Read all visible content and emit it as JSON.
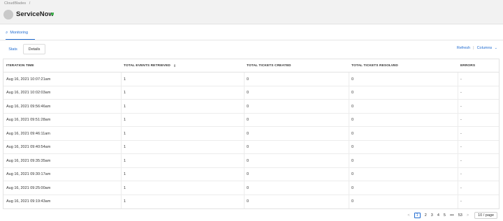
{
  "breadcrumb": {
    "root": "CloudBlades",
    "sep": "/"
  },
  "header": {
    "title": "ServiceNow"
  },
  "nav": {
    "monitoring_label": "Monitoring"
  },
  "tabs": {
    "stats": "Stats",
    "details": "Details"
  },
  "toolbar": {
    "refresh": "Refresh",
    "sep": "|",
    "columns": "Columns"
  },
  "table": {
    "headers": {
      "iteration_time": "ITERATION TIME",
      "total_events": "TOTAL EVENTS RETRIEVED",
      "tickets_created": "TOTAL TICKETS CREATED",
      "tickets_resolved": "TOTAL TICKETS RESOLVED",
      "errors": "ERRORS"
    },
    "rows": [
      {
        "time": "Aug 16, 2021 10:07:21am",
        "events": "1",
        "created": "0",
        "resolved": "0",
        "errors": "-"
      },
      {
        "time": "Aug 16, 2021 10:02:03am",
        "events": "1",
        "created": "0",
        "resolved": "0",
        "errors": "-"
      },
      {
        "time": "Aug 16, 2021 09:56:46am",
        "events": "1",
        "created": "0",
        "resolved": "0",
        "errors": "-"
      },
      {
        "time": "Aug 16, 2021 09:51:28am",
        "events": "1",
        "created": "0",
        "resolved": "0",
        "errors": "-"
      },
      {
        "time": "Aug 16, 2021 09:46:11am",
        "events": "1",
        "created": "0",
        "resolved": "0",
        "errors": "-"
      },
      {
        "time": "Aug 16, 2021 09:40:54am",
        "events": "1",
        "created": "0",
        "resolved": "0",
        "errors": "-"
      },
      {
        "time": "Aug 16, 2021 09:35:35am",
        "events": "1",
        "created": "0",
        "resolved": "0",
        "errors": "-"
      },
      {
        "time": "Aug 16, 2021 09:30:17am",
        "events": "1",
        "created": "0",
        "resolved": "0",
        "errors": "-"
      },
      {
        "time": "Aug 16, 2021 09:25:00am",
        "events": "1",
        "created": "0",
        "resolved": "0",
        "errors": "-"
      },
      {
        "time": "Aug 16, 2021 09:19:43am",
        "events": "1",
        "created": "0",
        "resolved": "0",
        "errors": "-"
      }
    ]
  },
  "pagination": {
    "prev": "<",
    "pages": [
      "1",
      "2",
      "3",
      "4",
      "5"
    ],
    "ellipsis": "•••",
    "last": "53",
    "next": ">",
    "page_size": "10 / page"
  },
  "colors": {
    "accent": "#1f6bd1",
    "status": "#3cb44b"
  },
  "icons": {
    "monitoring": "search-icon",
    "sort": "sort-icon",
    "columns": "chevron-down-icon"
  }
}
